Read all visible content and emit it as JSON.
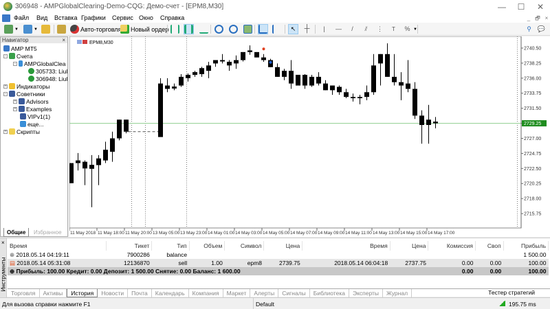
{
  "window": {
    "title": "306948 - AMPGlobalClearing-Demo-CQG: Демо-счет - [EPM8,M30]",
    "minimize": "—",
    "maximize": "☐",
    "close": "✕"
  },
  "menu": [
    "Файл",
    "Вид",
    "Вставка",
    "Графики",
    "Сервис",
    "Окно",
    "Справка"
  ],
  "mdi": [
    "_",
    "🗗",
    "×"
  ],
  "toolbar": {
    "autotrade": "Авто-торговля",
    "new_order": "Новый ордер"
  },
  "navigator": {
    "title": "Навигатор",
    "close": "×",
    "items": [
      "AMP MT5",
      "Счета",
      "AMPGlobalClea",
      "305733: Liul",
      "306948: Liul",
      "Индикаторы",
      "Советники",
      "Advisors",
      "Examples",
      "VIPv1(1)",
      "еще...",
      "Скрипты"
    ],
    "tabs": [
      "Общие",
      "Избранное"
    ]
  },
  "chart": {
    "symbol_label": "EPM8,M30"
  },
  "chart_data": {
    "type": "candlestick",
    "symbol": "EPM8",
    "timeframe": "M30",
    "ylim": [
      2714.5,
      2742.2
    ],
    "price_ticks": [
      "2740.50",
      "2738.25",
      "2736.00",
      "2733.75",
      "2731.50",
      "2729.25",
      "2727.00",
      "2724.75",
      "2722.50",
      "2720.25",
      "2718.00",
      "2715.75"
    ],
    "current_price": "2729.25",
    "time_labels": [
      "11 May 2018",
      "11 May 18:00",
      "11 May 20:00",
      "13 May 05:00",
      "13 May 23:00",
      "14 May 01:00",
      "14 May 03:00",
      "14 May 05:00",
      "14 May 07:00",
      "14 May 09:00",
      "14 May 11:00",
      "14 May 13:00",
      "14 May 15:00",
      "14 May 17:00"
    ],
    "bars": [
      [
        0,
        2720.3,
        2723.3,
        2720.3,
        2723.3
      ],
      [
        1,
        2723.3,
        2724.8,
        2722.2,
        2723.7
      ],
      [
        2,
        2723.5,
        2723.7,
        2720.0,
        2722.5
      ],
      [
        3,
        2723.05,
        2724.5,
        2716.7,
        2722.45
      ],
      [
        4,
        2723.0,
        2724.5,
        2720.0,
        2724.0
      ],
      [
        5,
        2723.7,
        2726.5,
        2723.3,
        2725.3
      ],
      [
        6,
        2725.0,
        2728.0,
        2723.5,
        2727.0
      ],
      [
        7,
        2727.0,
        2729.8,
        2726.7,
        2729.8
      ],
      [
        8,
        2729.8,
        2729.8,
        2727.75,
        2728.0
      ],
      [
        13,
        2727.2,
        2736.0,
        2727.2,
        2735.2
      ],
      [
        14,
        2734.4,
        2736.0,
        2733.9,
        2734.9
      ],
      [
        15,
        2734.45,
        2735.2,
        2734.2,
        2734.75
      ],
      [
        16,
        2734.9,
        2736.6,
        2734.7,
        2736.2
      ],
      [
        17,
        2736.0,
        2736.7,
        2735.5,
        2736.5
      ],
      [
        18,
        2736.5,
        2737.1,
        2736.2,
        2736.9
      ],
      [
        19,
        2736.6,
        2737.7,
        2736.2,
        2737.5
      ],
      [
        20,
        2737.1,
        2738.45,
        2736.0,
        2737.9
      ],
      [
        21,
        2738.2,
        2738.7,
        2737.7,
        2738.7
      ],
      [
        22,
        2738.5,
        2739.6,
        2738.2,
        2738.7
      ],
      [
        23,
        2738.45,
        2738.7,
        2737.1,
        2737.9
      ],
      [
        24,
        2738.2,
        2739.4,
        2737.4,
        2738.7
      ],
      [
        25,
        2738.7,
        2739.9,
        2738.5,
        2739.9
      ],
      [
        26,
        2739.9,
        2740.9,
        2739.5,
        2740.15
      ],
      [
        27,
        2739.9,
        2739.9,
        2739.1,
        2739.1
      ],
      [
        28,
        2739.1,
        2739.6,
        2738.45,
        2738.7
      ],
      [
        29,
        2738.7,
        2738.9,
        2737.65,
        2737.65
      ],
      [
        30,
        2737.65,
        2738.2,
        2736.2,
        2736.2
      ],
      [
        31,
        2737.1,
        2737.4,
        2735.7,
        2736.2
      ],
      [
        32,
        2735.2,
        2738.7,
        2734.4,
        2737.1
      ],
      [
        33,
        2736.5,
        2736.5,
        2734.9,
        2734.9
      ],
      [
        34,
        2736.5,
        2736.6,
        2734.4,
        2734.9
      ],
      [
        35,
        2734.9,
        2736.5,
        2734.7,
        2736.2
      ],
      [
        36,
        2736.2,
        2736.9,
        2734.9,
        2735.2
      ],
      [
        37,
        2735.2,
        2735.7,
        2734.2,
        2734.2
      ],
      [
        38,
        2734.9,
        2734.9,
        2733.5,
        2734.2
      ],
      [
        39,
        2734.7,
        2734.9,
        2733.5,
        2733.9
      ],
      [
        40,
        2733.9,
        2734.4,
        2733.0,
        2733.2
      ],
      [
        41,
        2733.2,
        2733.7,
        2732.5,
        2733.0
      ],
      [
        42,
        2733.0,
        2733.5,
        2732.1,
        2733.2
      ],
      [
        43,
        2733.2,
        2734.9,
        2732.7,
        2733.9
      ],
      [
        44,
        2733.9,
        2739.6,
        2733.5,
        2737.9
      ],
      [
        45,
        2738.2,
        2739.6,
        2734.9,
        2739.6
      ],
      [
        46,
        2739.6,
        2741.2,
        2736.2,
        2736.2
      ],
      [
        47,
        2736.2,
        2739.6,
        2734.9,
        2735.4
      ],
      [
        48,
        2735.4,
        2736.9,
        2732.7,
        2734.9
      ],
      [
        49,
        2734.4,
        2738.7,
        2733.9,
        2735.2
      ],
      [
        50,
        2734.4,
        2735.4,
        2729.9,
        2730.4
      ],
      [
        51,
        2730.4,
        2731.2,
        2726.2,
        2729.0
      ],
      [
        52,
        2729.8,
        2732.0,
        2726.2,
        2729.0
      ],
      [
        53,
        2729.5,
        2730.2,
        2728.5,
        2729.25
      ]
    ],
    "trades": [
      {
        "bar": 28,
        "price": 2739.75,
        "side": "sell"
      },
      {
        "bar": 29,
        "price": 2737.75,
        "side": "close"
      }
    ],
    "colors": {
      "candle": "#000000",
      "price_line": "#8fcf8f",
      "price_badge": "#1e8c1e"
    }
  },
  "toolbox": {
    "side_label": "Инструменты",
    "columns": [
      "Время",
      "Тикет",
      "Тип",
      "Объем",
      "Символ",
      "Цена",
      "Время",
      "Цена",
      "Комиссия",
      "Своп",
      "Прибыль"
    ],
    "rows": [
      [
        "2018.05.14 04:19:11",
        "7900286",
        "balance",
        "",
        "",
        "",
        "",
        "",
        "",
        "",
        "1 500.00"
      ],
      [
        "2018.05.14 05:31:08",
        "12136870",
        "sell",
        "1.00",
        "epm8",
        "2739.75",
        "2018.05.14 06:04:18",
        "2737.75",
        "0.00",
        "0.00",
        "100.00"
      ]
    ],
    "summary": {
      "text": "Прибыль: 100.00  Кредит: 0.00  Депозит: 1 500.00  Снятие: 0.00  Баланс: 1 600.00",
      "commission": "0.00",
      "swap": "0.00",
      "profit": "100.00"
    },
    "tabs": [
      "Торговля",
      "Активы",
      "История",
      "Новости",
      "Почта",
      "Календарь",
      "Компания",
      "Маркет",
      "Алерты",
      "Сигналы",
      "Библиотека",
      "Эксперты",
      "Журнал"
    ],
    "active_tab": "История",
    "tester": "Тестер стратегий"
  },
  "status": {
    "help": "Для вызова справки нажмите F1",
    "profile": "Default",
    "ping": "195.75 ms"
  }
}
